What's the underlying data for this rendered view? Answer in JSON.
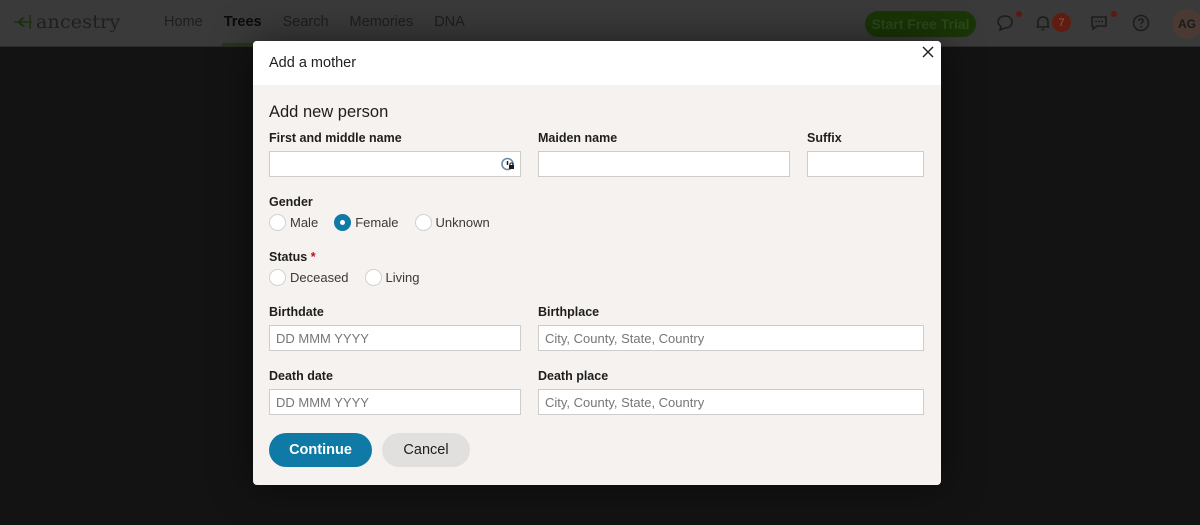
{
  "nav": {
    "logo_text": "ancestry",
    "links": [
      {
        "label": "Home",
        "active": false
      },
      {
        "label": "Trees",
        "active": true
      },
      {
        "label": "Search",
        "active": false
      },
      {
        "label": "Memories",
        "active": false
      },
      {
        "label": "DNA",
        "active": false
      }
    ],
    "trial_button": "Start Free Trial",
    "icons": [
      "speech-bubble-icon",
      "bell-icon",
      "message-icon",
      "help-icon"
    ],
    "notification_count": "7",
    "avatar_initials": "AG"
  },
  "modal": {
    "title": "Add a mother",
    "section_title": "Add new person",
    "fields": {
      "first_name": {
        "label": "First and middle name",
        "value": "",
        "placeholder": ""
      },
      "maiden_name": {
        "label": "Maiden name",
        "value": "",
        "placeholder": ""
      },
      "suffix": {
        "label": "Suffix",
        "value": "",
        "placeholder": ""
      },
      "birthdate": {
        "label": "Birthdate",
        "value": "",
        "placeholder": "DD MMM YYYY"
      },
      "birthplace": {
        "label": "Birthplace",
        "value": "",
        "placeholder": "City, County, State, Country"
      },
      "death_date": {
        "label": "Death date",
        "value": "",
        "placeholder": "DD MMM YYYY"
      },
      "death_place": {
        "label": "Death place",
        "value": "",
        "placeholder": "City, County, State, Country"
      }
    },
    "gender": {
      "label": "Gender",
      "options": [
        "Male",
        "Female",
        "Unknown"
      ],
      "selected": "Female"
    },
    "status": {
      "label": "Status",
      "required_mark": "*",
      "options": [
        "Deceased",
        "Living"
      ],
      "selected": null
    },
    "continue_label": "Continue",
    "cancel_label": "Cancel"
  },
  "colors": {
    "accent": "#0f7aa6",
    "required": "#b8131c",
    "modal_bg": "#f5f2ef",
    "backdrop": "#131313"
  }
}
